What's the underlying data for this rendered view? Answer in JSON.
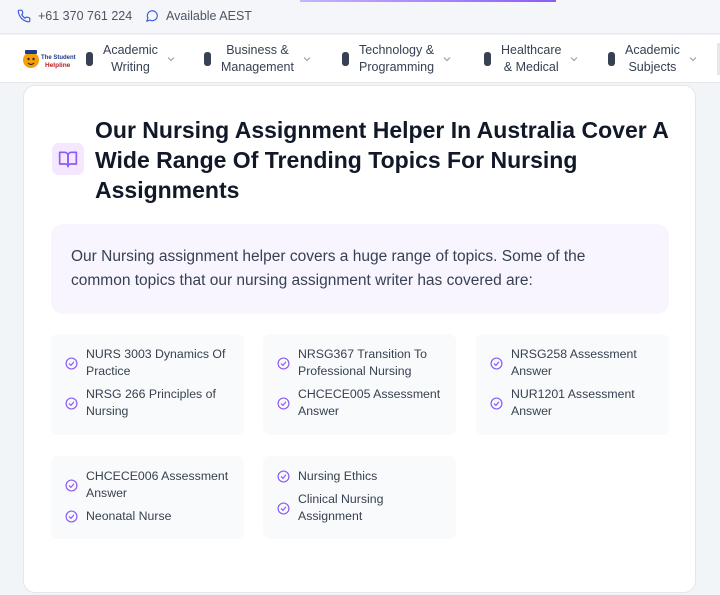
{
  "topbar": {
    "phone": "+61 370 761 224",
    "availability": "Available AEST",
    "icons": [
      "phone-icon",
      "chat-bubble-icon"
    ]
  },
  "logo": {
    "line1": "The Student",
    "line2": "Helpline"
  },
  "nav": {
    "items": [
      {
        "label": "Academic\nWriting"
      },
      {
        "label": "Business &\nManagement"
      },
      {
        "label": "Technology &\nProgramming"
      },
      {
        "label": "Healthcare\n& Medical"
      },
      {
        "label": "Academic\nSubjects"
      }
    ]
  },
  "section": {
    "title": "Our Nursing Assignment Helper In Australia Cover A Wide Range Of Trending Topics For Nursing Assignments",
    "intro": "Our Nursing assignment helper covers a huge range of topics. Some of the common topics that our nursing assignment writer has covered are:",
    "icon": "open-book-icon"
  },
  "topic_groups": [
    {
      "items": [
        "NURS 3003 Dynamics Of Practice",
        "NRSG 266 Principles of Nursing"
      ]
    },
    {
      "items": [
        "NRSG367 Transition To Professional Nursing",
        "CHCECE005 Assessment Answer"
      ]
    },
    {
      "items": [
        "NRSG258 Assessment Answer",
        "NUR1201 Assessment Answer"
      ]
    },
    {
      "items": [
        "CHCECE006 Assessment Answer",
        "Neonatal Nurse"
      ]
    },
    {
      "items": [
        "Nursing Ethics",
        "Clinical Nursing Assignment"
      ]
    }
  ],
  "colors": {
    "accent": "#8b5cf6",
    "icon_bg": "#f3e8ff",
    "intro_bg": "#f8f5ff",
    "topic_bg": "#f9fafb",
    "title": "#111827",
    "phone_icon": "#3b5bdb"
  }
}
